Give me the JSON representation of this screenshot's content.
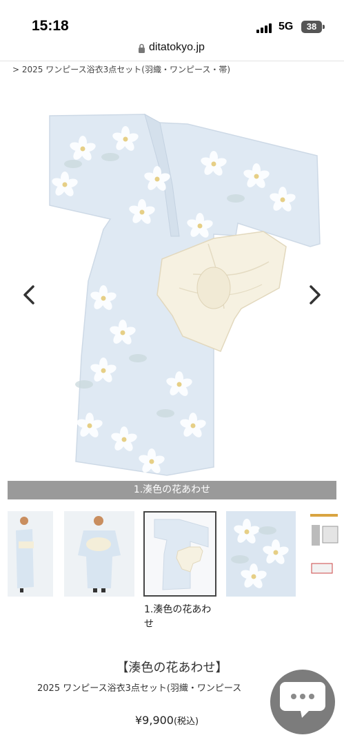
{
  "status_bar": {
    "time": "15:18",
    "network": "5G",
    "battery": "38"
  },
  "browser": {
    "url": "ditatokyo.jp"
  },
  "breadcrumb": "> 2025 ワンピース浴衣3点セット(羽織・ワンピース・帯)",
  "gallery": {
    "caption": "1.湊色の花あわせ",
    "selected_label": "1.湊色の花あわせ",
    "colors": {
      "fabric": "#dfe9f3",
      "obi": "#f6f1e1",
      "caption_bg": "#9a9a9a"
    }
  },
  "product": {
    "title": "【湊色の花あわせ】",
    "subtitle": "2025 ワンピース浴衣3点セット(羽織・ワンピース",
    "price": "¥9,900",
    "tax": "(税込)"
  },
  "chat": {
    "icon": "chat-bubble-icon"
  }
}
